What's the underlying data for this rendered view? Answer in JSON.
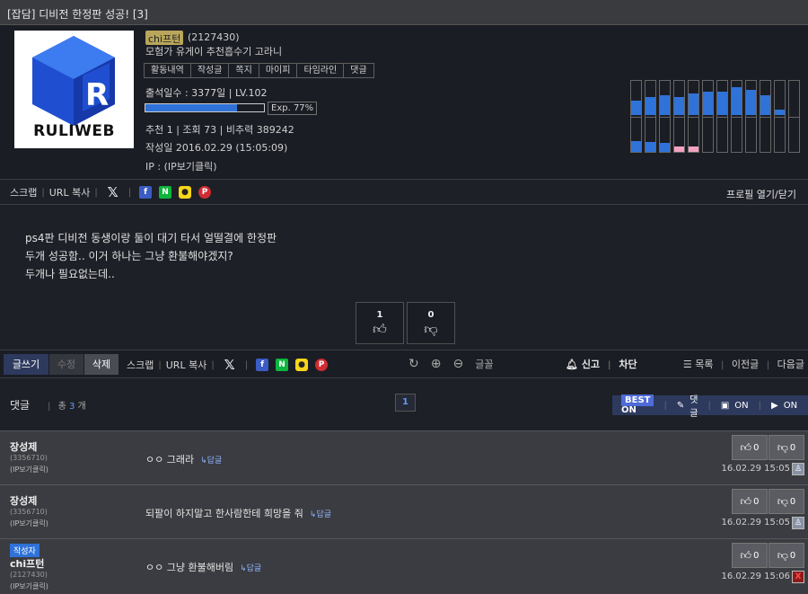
{
  "title": "[잡담] 디비전 한정판 성공! [3]",
  "profile": {
    "logo_text": "RULIWEB",
    "nickname": "chi프턴",
    "uid": "(2127430)",
    "motto": "모험가 유게이 추천흡수기 고라니",
    "tabs": [
      "활동내역",
      "작성글",
      "쪽지",
      "마이피",
      "타임라인",
      "댓글"
    ],
    "attendance": "출석일수 : 3377일 | LV.102",
    "exp_percent": 77,
    "exp_label": "Exp. 77%",
    "stats": "추천 1 | 조회 73 | 비추력 389242",
    "date": "작성일 2016.02.29 (15:05:09)",
    "ip": "IP : (IP보기클릭)",
    "activity_up": [
      0.4,
      0.5,
      0.55,
      0.5,
      0.6,
      0.65,
      0.65,
      0.78,
      0.7,
      0.55,
      0.15,
      0
    ],
    "activity_down": [
      0.3,
      0.28,
      0.25,
      0.15,
      0.15,
      0,
      0,
      0,
      0,
      0,
      0,
      0
    ],
    "activity_pink": [
      false,
      false,
      false,
      true,
      true,
      false,
      false,
      false,
      false,
      false,
      false,
      false
    ]
  },
  "share": {
    "scrap": "스크랩",
    "url_copy": "URL 복사",
    "profile_toggle": "프로필 열기/닫기"
  },
  "body": {
    "lines": [
      "ps4판 디비전 동생이랑 둘이 대기 타서 얼떨결에 한정판",
      "두개 성공함.. 이거 하나는 그냥 환불해야겠지?",
      "두개나 필요없는데.."
    ]
  },
  "votes": {
    "up": "1",
    "down": "0"
  },
  "actions": {
    "write": "글쓰기",
    "edit": "수정",
    "delete": "삭제",
    "scrap": "스크랩",
    "url_copy": "URL 복사",
    "font": "글꼴",
    "report": "신고",
    "block": "차단",
    "list": "목록",
    "prev": "이전글",
    "next": "다음글"
  },
  "comments_header": {
    "label": "댓글",
    "total_prefix": "총",
    "total": "3",
    "total_suffix": "개",
    "page": "1",
    "best": "BEST",
    "best_on": "ON",
    "reply_lbl": "댓글",
    "img_on": "ON",
    "vid_on": "ON"
  },
  "comments": [
    {
      "name": "장성제",
      "uid": "(3356710)",
      "ip": "(IP보기클릭)",
      "text": "ㅇㅇ 그래라",
      "reply": "↳답글",
      "up": "0",
      "down": "0",
      "date": "16.02.29 15:05"
    },
    {
      "name": "장성제",
      "uid": "(3356710)",
      "ip": "(IP보기클릭)",
      "text": "되팔이 하지말고 한사람한테 희망을 줘",
      "reply": "↳답글",
      "up": "0",
      "down": "0",
      "date": "16.02.29 15:05"
    },
    {
      "badge": "작성자",
      "name": "chi프턴",
      "uid": "(2127430)",
      "ip": "(IP보기클릭)",
      "text": "ㅇㅇ 그냥 환불해버림",
      "reply": "↳답글",
      "up": "0",
      "down": "0",
      "date": "16.02.29 15:06"
    }
  ],
  "colors": {
    "accent": "#2f72d8",
    "bg": "#1e2027",
    "comment_bg": "#3b3c41",
    "badge": "#b9a65a"
  }
}
